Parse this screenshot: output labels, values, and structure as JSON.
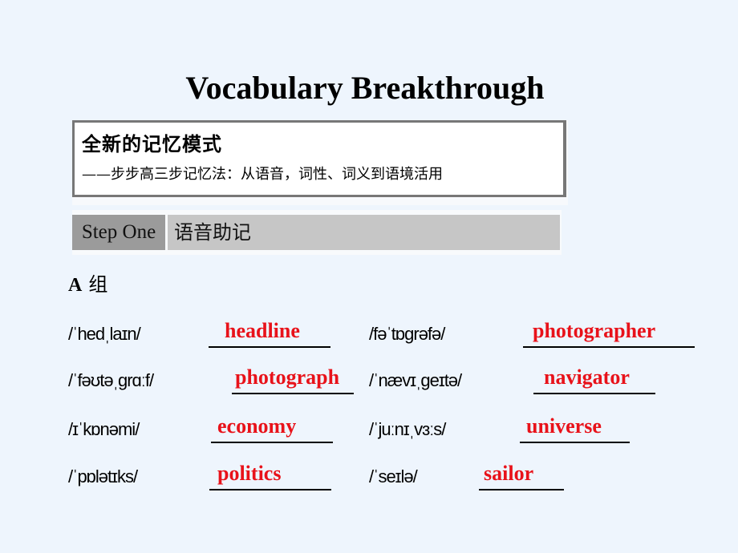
{
  "title": "Vocabulary Breakthrough",
  "intro_box": {
    "heading": "全新的记忆模式",
    "subheading": "——步步高三步记忆法：从语音，词性、词义到语境活用"
  },
  "step": {
    "label": "Step One",
    "title": "语音助记"
  },
  "group": {
    "letter": "A",
    "suffix": "组"
  },
  "colors": {
    "background": "#eef5fd",
    "answer": "#e8121a",
    "step_label_bg": "#9b9b9b",
    "step_title_bg": "#c6c6c6"
  },
  "items": [
    {
      "phonetic": "/ˈhedˌlaɪn/",
      "answer": "headline"
    },
    {
      "phonetic": "/fəˈtɒɡrəfə/",
      "answer": "photographer"
    },
    {
      "phonetic": "/ˈfəʊtəˌɡrɑːf/",
      "answer": "photograph"
    },
    {
      "phonetic": "/ˈnævɪˌɡeɪtə/",
      "answer": "navigator"
    },
    {
      "phonetic": "/ɪˈkɒnəmi/",
      "answer": "economy"
    },
    {
      "phonetic": "/ˈjuːnɪˌvɜːs/",
      "answer": "universe"
    },
    {
      "phonetic": "/ˈpɒlətɪks/",
      "answer": "politics"
    },
    {
      "phonetic": "/ˈseɪlə/",
      "answer": "sailor"
    }
  ]
}
